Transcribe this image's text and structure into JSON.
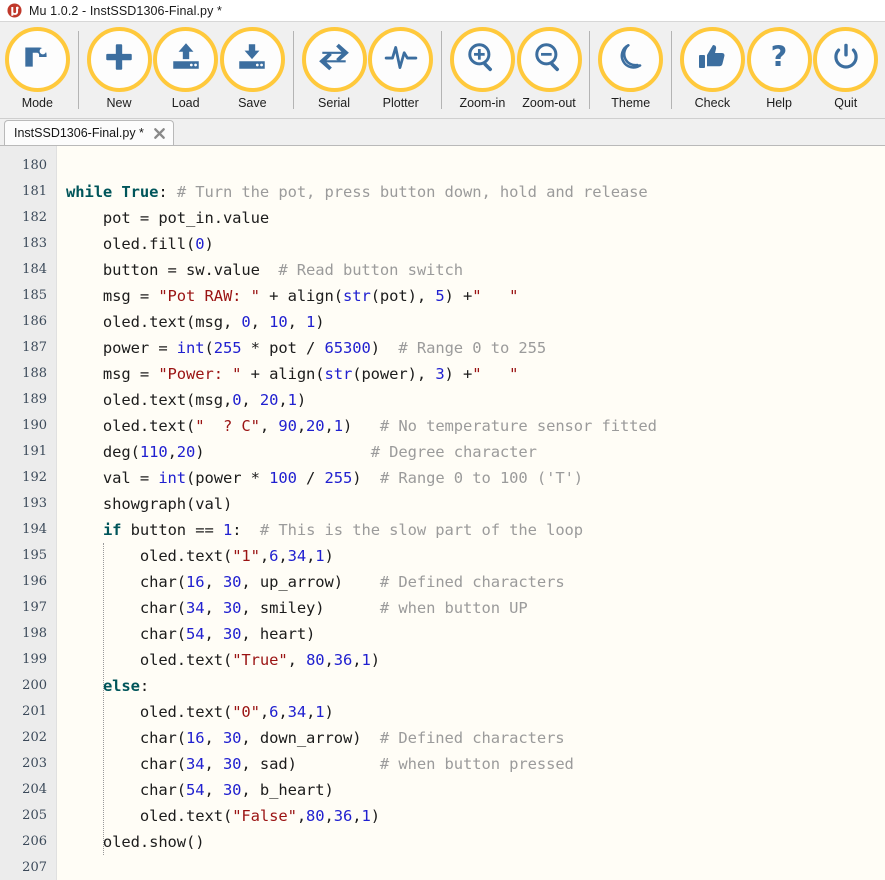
{
  "window": {
    "logo_icon": "mu-logo-icon",
    "title": "Mu 1.0.2 - InstSSD1306-Final.py *"
  },
  "toolbar": {
    "accent_color": "#ffc93c",
    "icon_color": "#3c6e9f",
    "background": "#f0f0f0",
    "buttons": [
      {
        "label": "Mode",
        "icon": "mode-icon"
      },
      {
        "label": "New",
        "icon": "plus-icon"
      },
      {
        "label": "Load",
        "icon": "upload-icon"
      },
      {
        "label": "Save",
        "icon": "download-icon"
      },
      {
        "label": "Serial",
        "icon": "arrows-exchange-icon"
      },
      {
        "label": "Plotter",
        "icon": "waveform-icon"
      },
      {
        "label": "Zoom-in",
        "icon": "magnifier-plus-icon"
      },
      {
        "label": "Zoom-out",
        "icon": "magnifier-minus-icon"
      },
      {
        "label": "Theme",
        "icon": "moon-icon"
      },
      {
        "label": "Check",
        "icon": "thumbs-up-icon"
      },
      {
        "label": "Help",
        "icon": "question-mark-icon"
      },
      {
        "label": "Quit",
        "icon": "power-icon"
      }
    ]
  },
  "tabs": [
    {
      "label": "InstSSD1306-Final.py *",
      "close_icon": "close-icon",
      "active": true
    }
  ],
  "editor": {
    "background": "#fffdf6",
    "gutter_background": "#ececec",
    "first_line_number": 180,
    "last_line_number": 207,
    "lines": [
      {
        "n": 180,
        "tokens": []
      },
      {
        "n": 181,
        "tokens": [
          {
            "t": "while",
            "c": "kw"
          },
          {
            "t": " ",
            "c": "pln"
          },
          {
            "t": "True",
            "c": "kw"
          },
          {
            "t": ":",
            "c": "pln"
          },
          {
            "t": " ",
            "c": "pln"
          },
          {
            "t": "# Turn the pot, press button down, hold and release",
            "c": "com"
          }
        ]
      },
      {
        "n": 182,
        "tokens": [
          {
            "t": "    pot = pot_in.value",
            "c": "pln"
          }
        ]
      },
      {
        "n": 183,
        "tokens": [
          {
            "t": "    oled.fill(",
            "c": "pln"
          },
          {
            "t": "0",
            "c": "num"
          },
          {
            "t": ")",
            "c": "pln"
          }
        ]
      },
      {
        "n": 184,
        "tokens": [
          {
            "t": "    button = sw.value",
            "c": "pln"
          },
          {
            "t": "  ",
            "c": "pln"
          },
          {
            "t": "# Read button switch",
            "c": "com"
          }
        ]
      },
      {
        "n": 185,
        "tokens": [
          {
            "t": "    msg = ",
            "c": "pln"
          },
          {
            "t": "\"Pot RAW: \"",
            "c": "str"
          },
          {
            "t": " + align(",
            "c": "pln"
          },
          {
            "t": "str",
            "c": "bi"
          },
          {
            "t": "(pot), ",
            "c": "pln"
          },
          {
            "t": "5",
            "c": "num"
          },
          {
            "t": ") +",
            "c": "pln"
          },
          {
            "t": "\"   \"",
            "c": "str"
          }
        ]
      },
      {
        "n": 186,
        "tokens": [
          {
            "t": "    oled.text(msg, ",
            "c": "pln"
          },
          {
            "t": "0",
            "c": "num"
          },
          {
            "t": ", ",
            "c": "pln"
          },
          {
            "t": "10",
            "c": "num"
          },
          {
            "t": ", ",
            "c": "pln"
          },
          {
            "t": "1",
            "c": "num"
          },
          {
            "t": ")",
            "c": "pln"
          }
        ]
      },
      {
        "n": 187,
        "tokens": [
          {
            "t": "    power = ",
            "c": "pln"
          },
          {
            "t": "int",
            "c": "bi"
          },
          {
            "t": "(",
            "c": "pln"
          },
          {
            "t": "255",
            "c": "num"
          },
          {
            "t": " * pot / ",
            "c": "pln"
          },
          {
            "t": "65300",
            "c": "num"
          },
          {
            "t": ")",
            "c": "pln"
          },
          {
            "t": "  ",
            "c": "pln"
          },
          {
            "t": "# Range 0 to 255",
            "c": "com"
          }
        ]
      },
      {
        "n": 188,
        "tokens": [
          {
            "t": "    msg = ",
            "c": "pln"
          },
          {
            "t": "\"Power: \"",
            "c": "str"
          },
          {
            "t": " + align(",
            "c": "pln"
          },
          {
            "t": "str",
            "c": "bi"
          },
          {
            "t": "(power), ",
            "c": "pln"
          },
          {
            "t": "3",
            "c": "num"
          },
          {
            "t": ") +",
            "c": "pln"
          },
          {
            "t": "\"   \"",
            "c": "str"
          }
        ]
      },
      {
        "n": 189,
        "tokens": [
          {
            "t": "    oled.text(msg,",
            "c": "pln"
          },
          {
            "t": "0",
            "c": "num"
          },
          {
            "t": ", ",
            "c": "pln"
          },
          {
            "t": "20",
            "c": "num"
          },
          {
            "t": ",",
            "c": "pln"
          },
          {
            "t": "1",
            "c": "num"
          },
          {
            "t": ")",
            "c": "pln"
          }
        ]
      },
      {
        "n": 190,
        "tokens": [
          {
            "t": "    oled.text(",
            "c": "pln"
          },
          {
            "t": "\"  ? C\"",
            "c": "str"
          },
          {
            "t": ", ",
            "c": "pln"
          },
          {
            "t": "90",
            "c": "num"
          },
          {
            "t": ",",
            "c": "pln"
          },
          {
            "t": "20",
            "c": "num"
          },
          {
            "t": ",",
            "c": "pln"
          },
          {
            "t": "1",
            "c": "num"
          },
          {
            "t": ")",
            "c": "pln"
          },
          {
            "t": "   ",
            "c": "pln"
          },
          {
            "t": "# No temperature sensor fitted",
            "c": "com"
          }
        ]
      },
      {
        "n": 191,
        "tokens": [
          {
            "t": "    deg(",
            "c": "pln"
          },
          {
            "t": "110",
            "c": "num"
          },
          {
            "t": ",",
            "c": "pln"
          },
          {
            "t": "20",
            "c": "num"
          },
          {
            "t": ")",
            "c": "pln"
          },
          {
            "t": "                  ",
            "c": "pln"
          },
          {
            "t": "# Degree character",
            "c": "com"
          }
        ]
      },
      {
        "n": 192,
        "tokens": [
          {
            "t": "    val = ",
            "c": "pln"
          },
          {
            "t": "int",
            "c": "bi"
          },
          {
            "t": "(power * ",
            "c": "pln"
          },
          {
            "t": "100",
            "c": "num"
          },
          {
            "t": " / ",
            "c": "pln"
          },
          {
            "t": "255",
            "c": "num"
          },
          {
            "t": ")",
            "c": "pln"
          },
          {
            "t": "  ",
            "c": "pln"
          },
          {
            "t": "# Range 0 to 100 ('T')",
            "c": "com"
          }
        ]
      },
      {
        "n": 193,
        "tokens": [
          {
            "t": "    showgraph(val)",
            "c": "pln"
          }
        ]
      },
      {
        "n": 194,
        "tokens": [
          {
            "t": "    ",
            "c": "pln"
          },
          {
            "t": "if",
            "c": "kw"
          },
          {
            "t": " button == ",
            "c": "pln"
          },
          {
            "t": "1",
            "c": "num"
          },
          {
            "t": ":",
            "c": "pln"
          },
          {
            "t": "  ",
            "c": "pln"
          },
          {
            "t": "# This is the slow part of the loop",
            "c": "com"
          }
        ]
      },
      {
        "n": 195,
        "tokens": [
          {
            "t": "        oled.text(",
            "c": "pln"
          },
          {
            "t": "\"1\"",
            "c": "str"
          },
          {
            "t": ",",
            "c": "pln"
          },
          {
            "t": "6",
            "c": "num"
          },
          {
            "t": ",",
            "c": "pln"
          },
          {
            "t": "34",
            "c": "num"
          },
          {
            "t": ",",
            "c": "pln"
          },
          {
            "t": "1",
            "c": "num"
          },
          {
            "t": ")",
            "c": "pln"
          }
        ]
      },
      {
        "n": 196,
        "tokens": [
          {
            "t": "        char(",
            "c": "pln"
          },
          {
            "t": "16",
            "c": "num"
          },
          {
            "t": ", ",
            "c": "pln"
          },
          {
            "t": "30",
            "c": "num"
          },
          {
            "t": ", up_arrow)",
            "c": "pln"
          },
          {
            "t": "    ",
            "c": "pln"
          },
          {
            "t": "# Defined characters",
            "c": "com"
          }
        ]
      },
      {
        "n": 197,
        "tokens": [
          {
            "t": "        char(",
            "c": "pln"
          },
          {
            "t": "34",
            "c": "num"
          },
          {
            "t": ", ",
            "c": "pln"
          },
          {
            "t": "30",
            "c": "num"
          },
          {
            "t": ", smiley)",
            "c": "pln"
          },
          {
            "t": "      ",
            "c": "pln"
          },
          {
            "t": "# when button UP",
            "c": "com"
          }
        ]
      },
      {
        "n": 198,
        "tokens": [
          {
            "t": "        char(",
            "c": "pln"
          },
          {
            "t": "54",
            "c": "num"
          },
          {
            "t": ", ",
            "c": "pln"
          },
          {
            "t": "30",
            "c": "num"
          },
          {
            "t": ", heart)",
            "c": "pln"
          }
        ]
      },
      {
        "n": 199,
        "tokens": [
          {
            "t": "        oled.text(",
            "c": "pln"
          },
          {
            "t": "\"True\"",
            "c": "str"
          },
          {
            "t": ", ",
            "c": "pln"
          },
          {
            "t": "80",
            "c": "num"
          },
          {
            "t": ",",
            "c": "pln"
          },
          {
            "t": "36",
            "c": "num"
          },
          {
            "t": ",",
            "c": "pln"
          },
          {
            "t": "1",
            "c": "num"
          },
          {
            "t": ")",
            "c": "pln"
          }
        ]
      },
      {
        "n": 200,
        "tokens": [
          {
            "t": "    ",
            "c": "pln"
          },
          {
            "t": "else",
            "c": "kw"
          },
          {
            "t": ":",
            "c": "pln"
          }
        ]
      },
      {
        "n": 201,
        "tokens": [
          {
            "t": "        oled.text(",
            "c": "pln"
          },
          {
            "t": "\"0\"",
            "c": "str"
          },
          {
            "t": ",",
            "c": "pln"
          },
          {
            "t": "6",
            "c": "num"
          },
          {
            "t": ",",
            "c": "pln"
          },
          {
            "t": "34",
            "c": "num"
          },
          {
            "t": ",",
            "c": "pln"
          },
          {
            "t": "1",
            "c": "num"
          },
          {
            "t": ")",
            "c": "pln"
          }
        ]
      },
      {
        "n": 202,
        "tokens": [
          {
            "t": "        char(",
            "c": "pln"
          },
          {
            "t": "16",
            "c": "num"
          },
          {
            "t": ", ",
            "c": "pln"
          },
          {
            "t": "30",
            "c": "num"
          },
          {
            "t": ", down_arrow)",
            "c": "pln"
          },
          {
            "t": "  ",
            "c": "pln"
          },
          {
            "t": "# Defined characters",
            "c": "com"
          }
        ]
      },
      {
        "n": 203,
        "tokens": [
          {
            "t": "        char(",
            "c": "pln"
          },
          {
            "t": "34",
            "c": "num"
          },
          {
            "t": ", ",
            "c": "pln"
          },
          {
            "t": "30",
            "c": "num"
          },
          {
            "t": ", sad)",
            "c": "pln"
          },
          {
            "t": "         ",
            "c": "pln"
          },
          {
            "t": "# when button pressed",
            "c": "com"
          }
        ]
      },
      {
        "n": 204,
        "tokens": [
          {
            "t": "        char(",
            "c": "pln"
          },
          {
            "t": "54",
            "c": "num"
          },
          {
            "t": ", ",
            "c": "pln"
          },
          {
            "t": "30",
            "c": "num"
          },
          {
            "t": ", b_heart)",
            "c": "pln"
          }
        ]
      },
      {
        "n": 205,
        "tokens": [
          {
            "t": "        oled.text(",
            "c": "pln"
          },
          {
            "t": "\"False\"",
            "c": "str"
          },
          {
            "t": ",",
            "c": "pln"
          },
          {
            "t": "80",
            "c": "num"
          },
          {
            "t": ",",
            "c": "pln"
          },
          {
            "t": "36",
            "c": "num"
          },
          {
            "t": ",",
            "c": "pln"
          },
          {
            "t": "1",
            "c": "num"
          },
          {
            "t": ")",
            "c": "pln"
          }
        ]
      },
      {
        "n": 206,
        "tokens": [
          {
            "t": "    oled.show()",
            "c": "pln"
          }
        ]
      },
      {
        "n": 207,
        "tokens": []
      }
    ]
  }
}
